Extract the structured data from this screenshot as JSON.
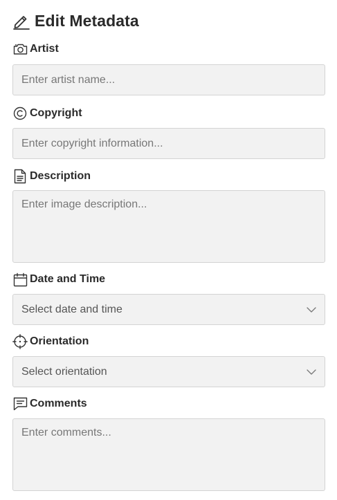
{
  "header": {
    "title": "Edit Metadata",
    "icon": "edit-pencil-icon"
  },
  "fields": {
    "artist": {
      "label": "Artist",
      "icon": "camera-icon",
      "placeholder": "Enter artist name...",
      "value": ""
    },
    "copyright": {
      "label": "Copyright",
      "icon": "copyright-icon",
      "placeholder": "Enter copyright information...",
      "value": ""
    },
    "description": {
      "label": "Description",
      "icon": "document-icon",
      "placeholder": "Enter image description...",
      "value": ""
    },
    "datetime": {
      "label": "Date and Time",
      "icon": "calendar-icon",
      "selected": "Select date and time"
    },
    "orientation": {
      "label": "Orientation",
      "icon": "crosshair-icon",
      "selected": "Select orientation"
    },
    "comments": {
      "label": "Comments",
      "icon": "comment-icon",
      "placeholder": "Enter comments...",
      "value": ""
    }
  },
  "colors": {
    "field_background": "#f2f2f2",
    "field_border": "#d3d3d3",
    "label_text": "#2a2a2a",
    "placeholder_text": "#777777"
  }
}
